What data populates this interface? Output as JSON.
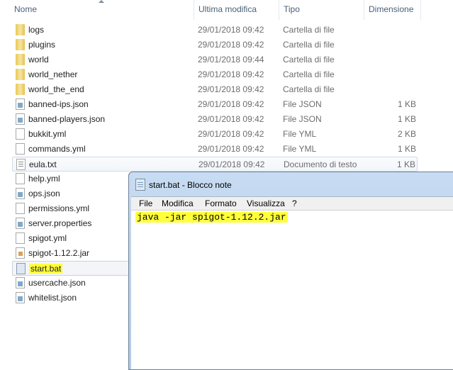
{
  "columns": {
    "name": "Nome",
    "modified": "Ultima modifica",
    "type": "Tipo",
    "size": "Dimensione"
  },
  "files": [
    {
      "name": "logs",
      "date": "29/01/2018 09:42",
      "type": "Cartella di file",
      "size": "",
      "icon": "folder"
    },
    {
      "name": "plugins",
      "date": "29/01/2018 09:42",
      "type": "Cartella di file",
      "size": "",
      "icon": "folder"
    },
    {
      "name": "world",
      "date": "29/01/2018 09:44",
      "type": "Cartella di file",
      "size": "",
      "icon": "folder"
    },
    {
      "name": "world_nether",
      "date": "29/01/2018 09:42",
      "type": "Cartella di file",
      "size": "",
      "icon": "folder"
    },
    {
      "name": "world_the_end",
      "date": "29/01/2018 09:42",
      "type": "Cartella di file",
      "size": "",
      "icon": "folder"
    },
    {
      "name": "banned-ips.json",
      "date": "29/01/2018 09:42",
      "type": "File JSON",
      "size": "1 KB",
      "icon": "json"
    },
    {
      "name": "banned-players.json",
      "date": "29/01/2018 09:42",
      "type": "File JSON",
      "size": "1 KB",
      "icon": "json"
    },
    {
      "name": "bukkit.yml",
      "date": "29/01/2018 09:42",
      "type": "File YML",
      "size": "2 KB",
      "icon": "blank"
    },
    {
      "name": "commands.yml",
      "date": "29/01/2018 09:42",
      "type": "File YML",
      "size": "1 KB",
      "icon": "blank"
    },
    {
      "name": "eula.txt",
      "date": "29/01/2018 09:42",
      "type": "Documento di testo",
      "size": "1 KB",
      "icon": "txt"
    },
    {
      "name": "help.yml",
      "date": "",
      "type": "",
      "size": "",
      "icon": "blank"
    },
    {
      "name": "ops.json",
      "date": "",
      "type": "",
      "size": "",
      "icon": "json"
    },
    {
      "name": "permissions.yml",
      "date": "",
      "type": "",
      "size": "",
      "icon": "blank"
    },
    {
      "name": "server.properties",
      "date": "",
      "type": "",
      "size": "",
      "icon": "json"
    },
    {
      "name": "spigot.yml",
      "date": "",
      "type": "",
      "size": "",
      "icon": "blank"
    },
    {
      "name": "spigot-1.12.2.jar",
      "date": "",
      "type": "",
      "size": "",
      "icon": "jar"
    },
    {
      "name": "start.bat",
      "date": "",
      "type": "",
      "size": "",
      "icon": "bat"
    },
    {
      "name": "usercache.json",
      "date": "",
      "type": "",
      "size": "",
      "icon": "json"
    },
    {
      "name": "whitelist.json",
      "date": "",
      "type": "",
      "size": "",
      "icon": "json"
    }
  ],
  "notepad": {
    "title": "start.bat - Blocco note",
    "menu": [
      "File",
      "Modifica",
      "Formato",
      "Visualizza",
      "?"
    ],
    "content": "java -jar spigot-1.12.2.jar"
  }
}
